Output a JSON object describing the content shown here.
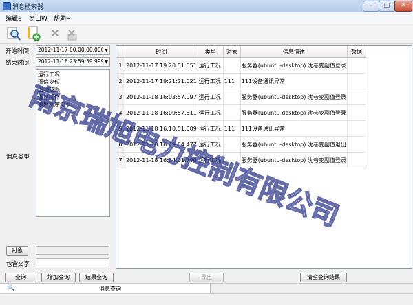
{
  "window": {
    "title": "消息检索器",
    "min": "–",
    "max": "□",
    "close": "✕"
  },
  "menu": [
    {
      "label": "编辑E"
    },
    {
      "label": "窗口W"
    },
    {
      "label": "帮助H"
    }
  ],
  "toolbar": {
    "icons": [
      "search-icon",
      "add-document-icon",
      "delete-icon",
      "disabled-delete-icon"
    ]
  },
  "filters": {
    "start_label": "开始时间",
    "start_value": "2012-11-17 00:00:00.000",
    "end_label": "结束时间",
    "end_value": "2012-11-18 23:59:59.999",
    "msgtype_label": "消息类型",
    "msgtypes": [
      "运行工况",
      "遥信变位",
      "遥测越限",
      "遥控操作",
      "事件顺序记录"
    ],
    "object_button": "对象",
    "contains_label": "包含文字",
    "contains_value": ""
  },
  "table": {
    "columns": [
      "",
      "时间",
      "类型",
      "对象",
      "信息描述",
      "数据"
    ],
    "rows": [
      [
        "1",
        "2012-11-17 19:20:51.551",
        "运行工况",
        "",
        "服务器(ubuntu-desktop) 沈巷变副值登录",
        ""
      ],
      [
        "2",
        "2012-11-17 19:21:21.021",
        "运行工况",
        "111",
        "111设备通讯异常",
        ""
      ],
      [
        "3",
        "2012-11-18 16:03:57.097",
        "运行工况",
        "",
        "服务器(ubuntu-desktop) 沈巷变副值登录",
        ""
      ],
      [
        "4",
        "2012-11-18 16:09:57.511",
        "运行工况",
        "",
        "服务器(ubuntu-desktop) 沈巷变副值登录",
        ""
      ],
      [
        "5",
        "2012-11-18 16:10:51.009",
        "运行工况",
        "111",
        "111设备通讯异常",
        ""
      ],
      [
        "6",
        "2012-11-18 16:49:04.477",
        "运行工况",
        "",
        "服务器(ubuntu-desktop) 沈巷变副值退出",
        ""
      ],
      [
        "7",
        "2012-11-18 16:54:01.790",
        "运行工况",
        "",
        "服务器(ubuntu-desktop) 沈巷变副值登录",
        ""
      ]
    ]
  },
  "buttons": {
    "query": "查询",
    "add_query": "增加查询",
    "result_query": "结果查询",
    "export": "导出",
    "clear": "清空查询结果"
  },
  "tab": {
    "label": "消息查询"
  },
  "watermark": "南京瑞旭电力控制有限公司",
  "colors": {
    "titlebar": "#c4d8ef",
    "watermark": "#2f3a8c"
  }
}
